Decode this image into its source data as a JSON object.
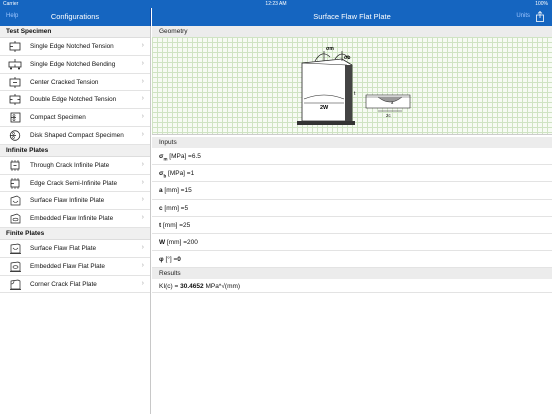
{
  "status": {
    "carrier": "Carrier",
    "time": "12:23 AM",
    "battery": "100%"
  },
  "left_nav": {
    "back_label": "Help",
    "title": "Configurations"
  },
  "right_nav": {
    "title": "Surface Flaw Flat Plate",
    "edit_label": "Units"
  },
  "sections": [
    {
      "title": "Test Specimen",
      "items": [
        "Single Edge Notched Tension",
        "Single Edge Notched Bending",
        "Center Cracked Tension",
        "Double Edge Notched Tension",
        "Compact Specimen",
        "Disk Shaped Compact Specimen"
      ]
    },
    {
      "title": "Infinite Plates",
      "items": [
        "Through Crack Infinite Plate",
        "Edge Crack Semi-Infinite Plate",
        "Surface Flaw Infinite Plate",
        "Embedded Flaw Infinite Plate"
      ]
    },
    {
      "title": "Finite Plates",
      "items": [
        "Surface Flaw Flat Plate",
        "Embedded Flaw Flat Plate",
        "Corner Crack Flat Plate"
      ]
    }
  ],
  "detail": {
    "geometry_title": "Geometry",
    "diagram_labels": {
      "sigma_m": "σm",
      "sigma_b": "σb",
      "w": "2W",
      "a": "a",
      "c": "2c",
      "t": "t"
    },
    "inputs_title": "Inputs",
    "inputs": [
      {
        "symbol": "σ",
        "sub": "m",
        "unit": " [MPa] =",
        "value": "6.5"
      },
      {
        "symbol": "σ",
        "sub": "b",
        "unit": " [MPa] =",
        "value": "1"
      },
      {
        "symbol": "a",
        "sub": "",
        "unit": " [mm] =",
        "value": "15"
      },
      {
        "symbol": "c",
        "sub": "",
        "unit": " [mm] =",
        "value": "5"
      },
      {
        "symbol": "t",
        "sub": "",
        "unit": " [mm] =",
        "value": "25"
      },
      {
        "symbol": "W",
        "sub": "",
        "unit": " [mm] =",
        "value": "200"
      },
      {
        "symbol": "φ",
        "sub": "",
        "unit": " [°] =",
        "value": "0"
      }
    ],
    "results_title": "Results",
    "result": {
      "label": "KI(c) = ",
      "value": "30.4652",
      "unit": "  MPa*√(mm)"
    }
  }
}
